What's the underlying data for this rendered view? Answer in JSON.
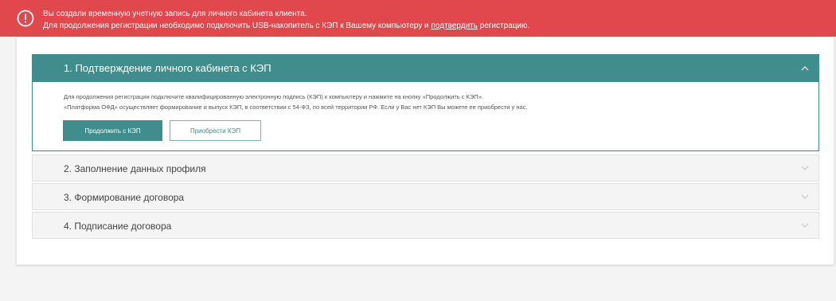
{
  "alert": {
    "icon": "exclamation-circle-icon",
    "line1": "Вы создали временную учетную запись для личного кабинета клиента.",
    "line2_before": "Для продолжения регистрации необходимо подключить USB-накопитель с КЭП к Вашему компьютеру и ",
    "line2_link": "подтвердить",
    "line2_after": " регистрацию.",
    "color": "#e0484e"
  },
  "steps": {
    "step1": {
      "title": "1. Подтверждение личного кабинета с КЭП",
      "expanded": true,
      "body_line1": "Для продолжения регистрации подключите квалифицированную электронную подпись (КЭП) к компьютеру и нажмите на кнопку «Продолжить с КЭП».",
      "body_line2": "«Платформа ОФД» осуществляет формирование и выпуск КЭП, в соответствии с 54-ФЗ, по всей территории РФ. Если у Вас нет КЭП Вы можете ее приобрести у нас.",
      "primary_button": "Продолжить с КЭП",
      "secondary_button": "Приобрести КЭП",
      "icon": "chevron-up-icon"
    },
    "step2": {
      "title": "2. Заполнение данных профиля",
      "expanded": false,
      "icon": "chevron-down-icon"
    },
    "step3": {
      "title": "3. Формирование договора",
      "expanded": false,
      "icon": "chevron-down-icon"
    },
    "step4": {
      "title": "4. Подписание договора",
      "expanded": false,
      "icon": "chevron-down-icon"
    }
  },
  "colors": {
    "accent": "#3f8d8c",
    "alert": "#e0484e",
    "collapsed_step_bg": "#f4f4f4"
  }
}
